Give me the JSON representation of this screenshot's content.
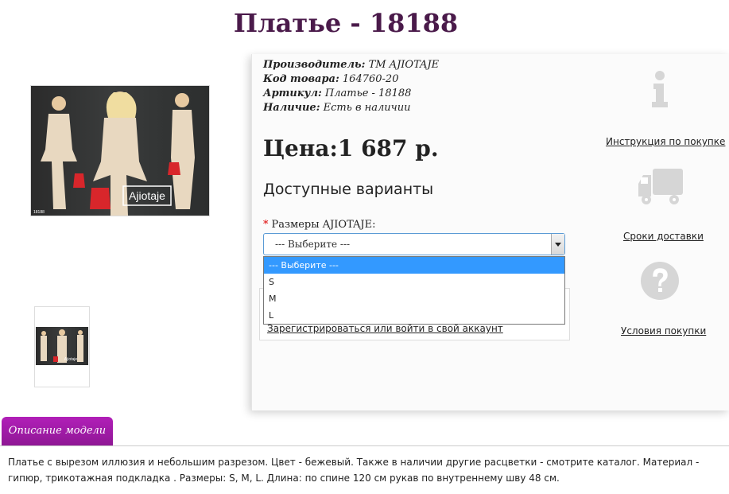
{
  "product": {
    "title": "Платье - 18188",
    "manufacturer_label": "Производитель:",
    "manufacturer_value": "ТМ AJIOTAJE",
    "code_label": "Код товара:",
    "code_value": "164760-20",
    "article_label": "Артикул:",
    "article_value": "Платье - 18188",
    "availability_label": "Наличие:",
    "availability_value": "Есть в наличии",
    "price": "Цена:1 687 р.",
    "image_brand_text": "Ajiotaje",
    "image_corner_text": "18188",
    "thumb_brand_text": "Ajiotaje"
  },
  "variants": {
    "title": "Доступные варианты",
    "size_label": "Размеры AJIOTAJE:",
    "required_mark": "*",
    "select_value": "--- Выберите ---",
    "options": [
      "--- Выберите ---",
      "S",
      "M",
      "L"
    ],
    "login_link": "Зарегистрироваться или войти в свой аккаунт"
  },
  "sidebar": {
    "instruction_link": "Инструкция по покупке",
    "delivery_link": "Сроки доставки",
    "terms_link": "Условия покупки"
  },
  "description": {
    "tab_label": "Описание модели",
    "text": "Платье с вырезом иллюзия и небольшим разрезом. Цвет - бежевый. Также в наличии другие расцветки - смотрите каталог. Материал - гипюр, трикотажная подкладка . Размеры: S, M, L. Длина: по спине 120 см рукав по внутреннему шву 48 см."
  },
  "colors": {
    "title": "#4a1a4a",
    "tab": "#a01ca6",
    "dropdown_selected": "#3399ff",
    "dress": "#e8d8c0",
    "bag": "#d8262b"
  },
  "icons": [
    "info-icon",
    "truck-icon",
    "question-icon"
  ]
}
